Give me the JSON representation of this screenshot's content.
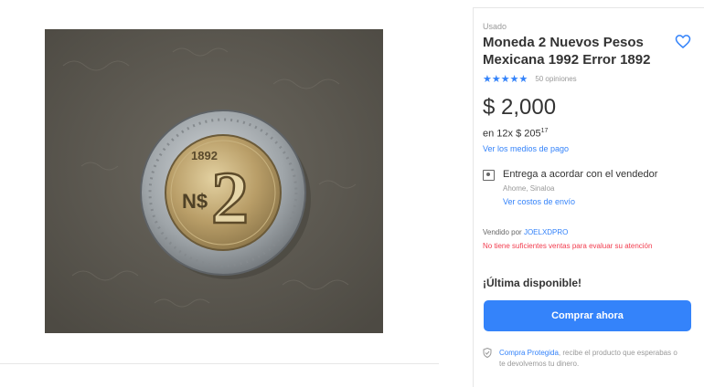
{
  "product": {
    "condition": "Usado",
    "title": "Moneda 2 Nuevos Pesos Mexicana 1992 Error 1892",
    "rating": 4.5,
    "rating_stars": "★★★★★",
    "ratings_count": "50 opiniones",
    "price": "$ 2,000",
    "installments_prefix": "en 12x $ 205",
    "installments_cents": "17",
    "payment_methods_link": "Ver los medios de pago",
    "image_alt": "Moneda mexicana de 2 nuevos pesos"
  },
  "coin": {
    "year_text": "1892",
    "denomination": "2",
    "currency_mark": "N$"
  },
  "shipping": {
    "icon": "calendar-icon",
    "title": "Entrega a acordar con el vendedor",
    "location": "Ahome, Sinaloa",
    "costs_link": "Ver costos de envío"
  },
  "seller": {
    "prefix": "Vendido por",
    "name": "JOELXDPRO",
    "warning": "No tiene suficientes ventas para evaluar su atención"
  },
  "stock": {
    "label": "¡Última disponible!"
  },
  "purchase": {
    "buy_label": "Comprar ahora"
  },
  "protection": {
    "link": "Compra Protegida",
    "text": ", recibe el producto que esperabas o te devolvemos tu dinero."
  },
  "colors": {
    "accent": "#3483fa",
    "warning": "#f23d4f",
    "muted": "#999999"
  }
}
